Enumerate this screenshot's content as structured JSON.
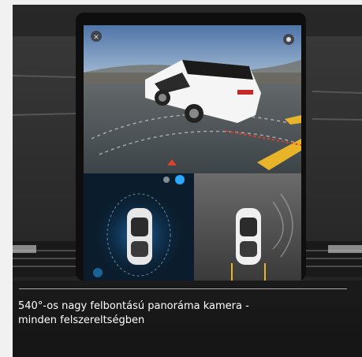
{
  "caption": {
    "line1": "540°-os nagy felbontású panoráma kamera -",
    "line2": "minden felszereltségben"
  },
  "colors": {
    "page_background": "#f1f1f1",
    "photo_background": "#2a2a2a",
    "screen_sky": "#6f8fb6",
    "accent_blue": "#29a9ff"
  },
  "icons": [
    "close-icon",
    "camera-toggle-icon",
    "view-mode-icon"
  ]
}
